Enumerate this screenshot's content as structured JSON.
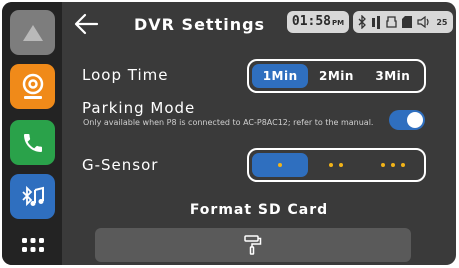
{
  "header": {
    "title": "DVR Settings",
    "time": "01:58",
    "ampm": "PM",
    "volume_level": "25"
  },
  "sidebar": {
    "items": [
      {
        "icon": "home-icon"
      },
      {
        "icon": "dashcam-icon"
      },
      {
        "icon": "phone-icon"
      },
      {
        "icon": "bluetooth-music-icon"
      },
      {
        "icon": "app-grid-icon"
      }
    ]
  },
  "loop_time": {
    "label": "Loop Time",
    "options": [
      "1Min",
      "2Min",
      "3Min"
    ],
    "selected": "1Min"
  },
  "parking_mode": {
    "label": "Parking Mode",
    "note": "Only available when P8 is connected to AC-P8AC12; refer to the manual.",
    "enabled": true
  },
  "g_sensor": {
    "label": "G-Sensor",
    "levels": [
      1,
      2,
      3
    ],
    "selected": 1
  },
  "format": {
    "label": "Format SD Card",
    "icon": "paint-roller-icon"
  },
  "colors": {
    "accent": "#2f6fbf",
    "dot": "#f2b318",
    "camera": "#f08a19",
    "phone": "#2aa24a"
  }
}
